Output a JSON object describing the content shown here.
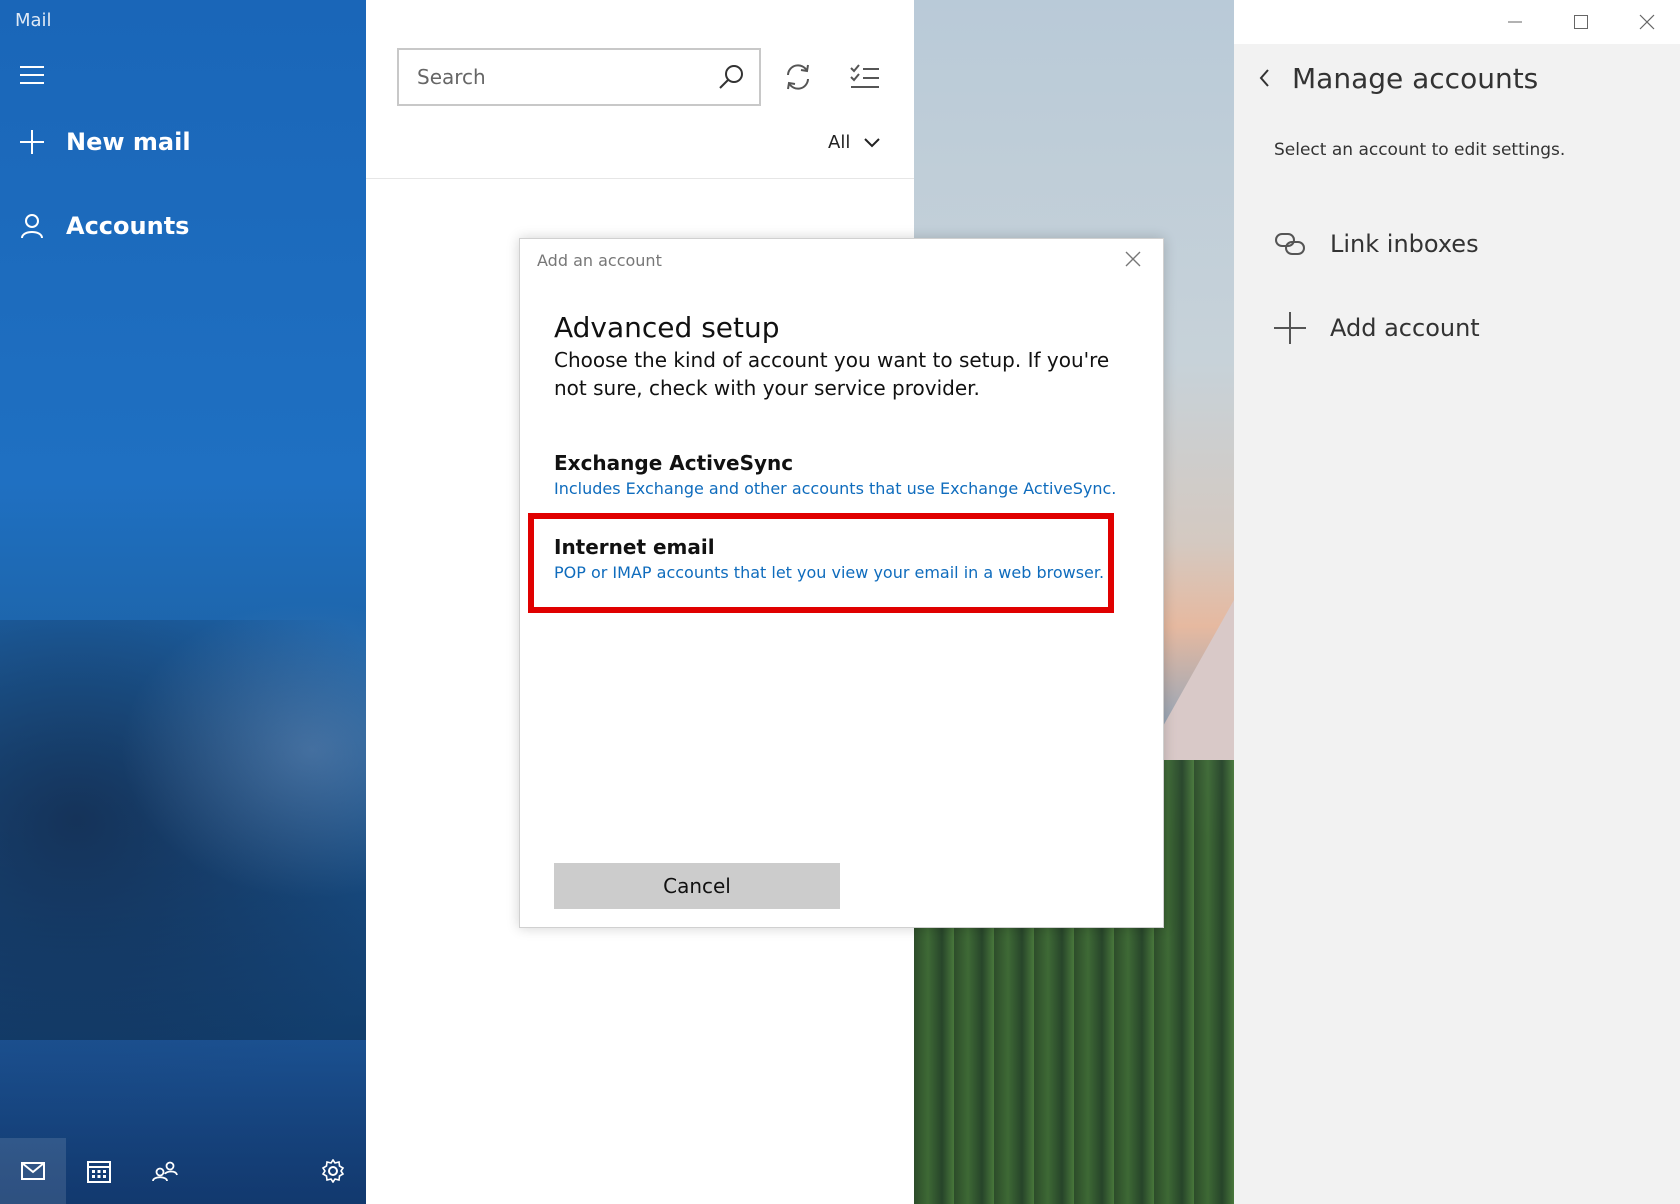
{
  "app": {
    "title": "Mail"
  },
  "nav": {
    "new_mail": "New mail",
    "accounts": "Accounts",
    "bottom_icons": [
      "mail-icon",
      "calendar-icon",
      "people-icon",
      "settings-icon"
    ]
  },
  "list": {
    "search_placeholder": "Search",
    "filter": "All"
  },
  "panel": {
    "title": "Manage accounts",
    "subtitle": "Select an account to edit settings.",
    "link_inboxes": "Link inboxes",
    "add_account": "Add account"
  },
  "dialog": {
    "title": "Add an account",
    "heading": "Advanced setup",
    "description": "Choose the kind of account you want to setup. If you're not sure, check with your service provider.",
    "options": [
      {
        "title": "Exchange ActiveSync",
        "description": "Includes Exchange and other accounts that use Exchange ActiveSync."
      },
      {
        "title": "Internet email",
        "description": "POP or IMAP accounts that let you view your email in a web browser."
      }
    ],
    "cancel": "Cancel"
  },
  "colors": {
    "nav_blue": "#1f70c2",
    "link_blue": "#0f6cbd",
    "highlight_red": "#e00000",
    "button_gray": "#cccccc"
  }
}
